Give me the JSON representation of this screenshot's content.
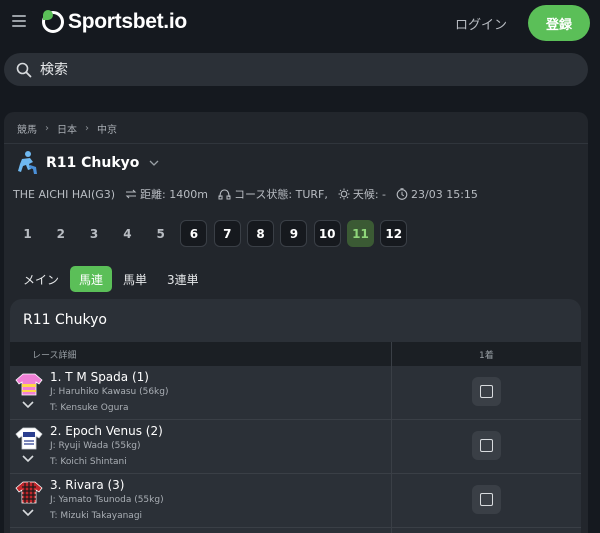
{
  "header": {
    "brand": "Sportsbet.io",
    "login_label": "ログイン",
    "signup_label": "登録",
    "accent_color": "#5bbf58"
  },
  "search": {
    "placeholder": "検索"
  },
  "breadcrumb": [
    "競馬",
    "日本",
    "中京"
  ],
  "race": {
    "title": "R11 Chukyo",
    "info": {
      "race_name": "THE AICHI HAI(G3)",
      "distance": "距離: 1400m",
      "course": "コース状態: TURF,",
      "weather": "天候: -",
      "time": "23/03 15:15"
    },
    "race_numbers": [
      "1",
      "2",
      "3",
      "4",
      "5",
      "6",
      "7",
      "8",
      "9",
      "10",
      "11",
      "12"
    ],
    "active_race": "11"
  },
  "bet_tabs": [
    "メイン",
    "馬連",
    "馬単",
    "3連単"
  ],
  "active_bet_tab": "馬連",
  "card": {
    "title": "R11 Chukyo",
    "col_details": "レース詳細",
    "col_first": "1着",
    "runners": [
      {
        "name": "1. T M Spada (1)",
        "jockey": "J: Haruhiko Kawasu (56kg)",
        "trainer": "T: Kensuke Ogura",
        "silk_icon": "pink-silk-icon"
      },
      {
        "name": "2. Epoch Venus (2)",
        "jockey": "J: Ryuji Wada (55kg)",
        "trainer": "T: Koichi Shintani",
        "silk_icon": "white-silk-icon"
      },
      {
        "name": "3. Rivara (3)",
        "jockey": "J: Yamato Tsunoda (55kg)",
        "trainer": "T: Mizuki Takayanagi",
        "silk_icon": "red-check-silk-icon"
      }
    ]
  }
}
